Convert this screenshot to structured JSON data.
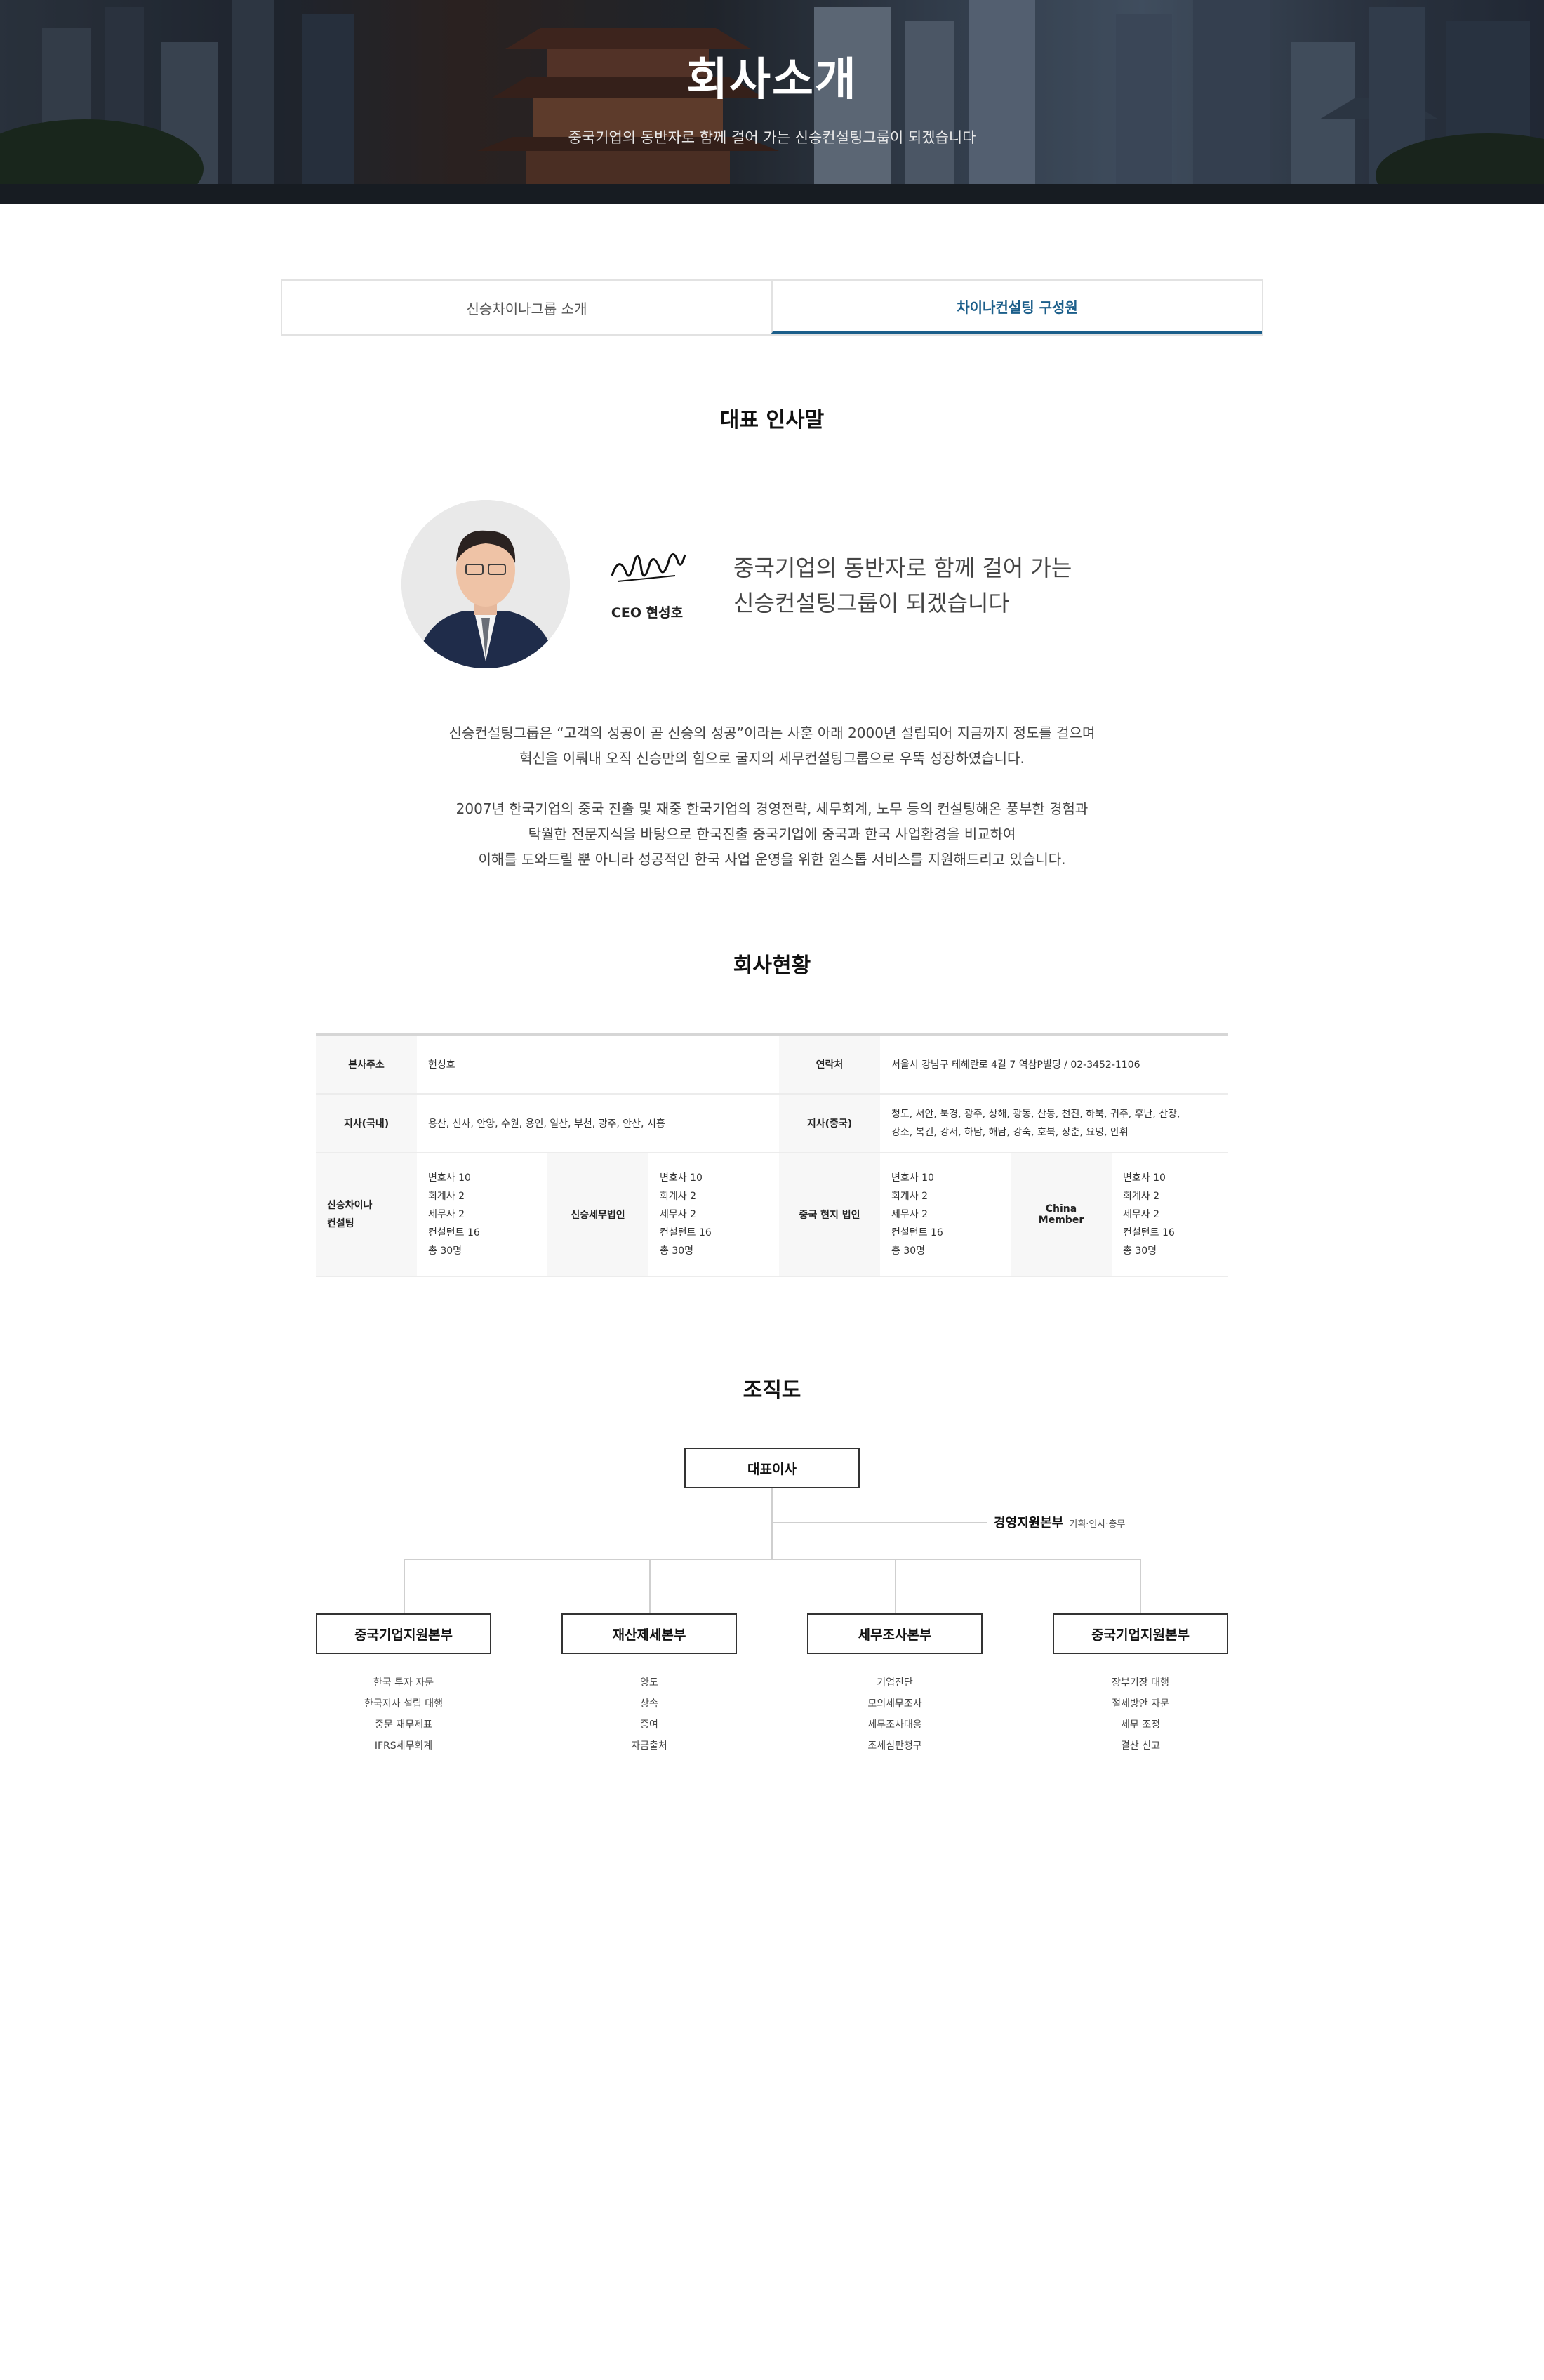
{
  "hero": {
    "title": "회사소개",
    "subtitle": "중국기업의 동반자로 함께 걸어 가는 신승컨설팅그룹이 되겠습니다"
  },
  "tabs": [
    {
      "label": "신승차이나그룹 소개",
      "active": false
    },
    {
      "label": "차이나컨설팅 구성원",
      "active": true
    }
  ],
  "greeting": {
    "title": "대표 인사말",
    "ceo_name": "CEO 현성호",
    "message": [
      "중국기업의 동반자로 함께 걸어 가는",
      "신승컨설팅그룹이 되겠습니다"
    ],
    "paragraph1": [
      "신승컨설팅그룹은 “고객의 성공이 곧 신승의 성공”이라는 사훈 아래 2000년 설립되어 지금까지 정도를 걸으며",
      "혁신을 이뤄내 오직 신승만의 힘으로 굴지의 세무컨설팅그룹으로 우뚝 성장하였습니다."
    ],
    "paragraph2": [
      "2007년 한국기업의 중국 진출 및 재중 한국기업의 경영전략, 세무회계, 노무 등의 컨설팅해온 풍부한 경험과",
      "탁월한 전문지식을 바탕으로 한국진출 중국기업에 중국과 한국 사업환경을 비교하여",
      "이해를 도와드릴 뿐 아니라 성공적인 한국 사업 운영을 위한 원스톱 서비스를 지원해드리고 있습니다."
    ]
  },
  "company_status": {
    "title": "회사현황",
    "row1": {
      "h1": "본사주소",
      "v1": "현성호",
      "h2": "연락처",
      "v2": "서울시 강남구 테헤란로 4길 7 역삼P빌딩 / 02-3452-1106"
    },
    "row2": {
      "h1": "지사(국내)",
      "v1": "용산, 신사, 안양, 수원, 용인, 일산, 부천, 광주, 안산, 시흥",
      "h2": "지사(중국)",
      "v2": [
        "청도, 서안, 북경, 광주, 상해, 광동, 산동, 천진, 하북, 귀주, 후난, 산장,",
        "강소, 복건, 강서, 하남, 해남, 강숙, 호북, 장춘, 요녕, 안휘"
      ]
    },
    "row3": [
      {
        "header": [
          "신승차이나",
          "컨설팅"
        ],
        "lines": [
          "변호사 10",
          "회계사 2",
          "세무사 2",
          "컨설턴트 16",
          "총 30명"
        ]
      },
      {
        "header": [
          "신승세무법인"
        ],
        "lines": [
          "변호사 10",
          "회계사 2",
          "세무사 2",
          "컨설턴트 16",
          "총 30명"
        ]
      },
      {
        "header": [
          "중국 현지 법인"
        ],
        "lines": [
          "변호사 10",
          "회계사 2",
          "세무사 2",
          "컨설턴트 16",
          "총 30명"
        ]
      },
      {
        "header": [
          "China Member"
        ],
        "lines": [
          "변호사 10",
          "회계사 2",
          "세무사 2",
          "컨설턴트 16",
          "총 30명"
        ]
      }
    ]
  },
  "org": {
    "title": "조직도",
    "ceo": "대표이사",
    "mgmt": "경영지원본부",
    "mgmt_sub": "기획·인사·총무",
    "departments": [
      {
        "name": "중국기업지원본부",
        "items": [
          "한국 투자 자문",
          "한국지사 설립 대행",
          "중문 재무제표",
          "IFRS세무회계"
        ]
      },
      {
        "name": "재산제세본부",
        "items": [
          "양도",
          "상속",
          "증여",
          "자금출처"
        ]
      },
      {
        "name": "세무조사본부",
        "items": [
          "기업진단",
          "모의세무조사",
          "세무조사대응",
          "조세심판청구"
        ]
      },
      {
        "name": "중국기업지원본부",
        "items": [
          "장부기장 대행",
          "절세방안 자문",
          "세무 조정",
          "결산 신고"
        ]
      }
    ]
  },
  "colors": {
    "accent": "#1b5e8a",
    "table_header_bg": "#f7f7f7",
    "border": "#e2e2e2"
  }
}
